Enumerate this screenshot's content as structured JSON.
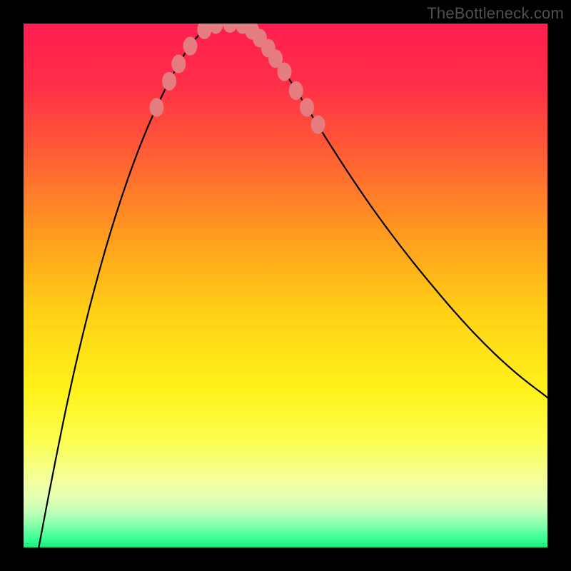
{
  "watermark": "TheBottleneck.com",
  "chart_data": {
    "type": "line",
    "title": "",
    "xlabel": "",
    "ylabel": "",
    "xlim": [
      0,
      1
    ],
    "ylim": [
      0,
      1
    ],
    "gradient_stops": [
      {
        "offset": 0.0,
        "color": "#ff1d51"
      },
      {
        "offset": 0.12,
        "color": "#ff3047"
      },
      {
        "offset": 0.25,
        "color": "#ff5e35"
      },
      {
        "offset": 0.4,
        "color": "#ff9a1f"
      },
      {
        "offset": 0.55,
        "color": "#ffd015"
      },
      {
        "offset": 0.7,
        "color": "#fff21a"
      },
      {
        "offset": 0.8,
        "color": "#fbff53"
      },
      {
        "offset": 0.86,
        "color": "#f5ff92"
      },
      {
        "offset": 0.9,
        "color": "#e9ffb0"
      },
      {
        "offset": 0.93,
        "color": "#c4ffb9"
      },
      {
        "offset": 0.96,
        "color": "#7dffa9"
      },
      {
        "offset": 0.985,
        "color": "#35ff93"
      },
      {
        "offset": 1.0,
        "color": "#18e87a"
      }
    ],
    "series": [
      {
        "name": "left-branch",
        "kind": "curve",
        "points": [
          [
            0.029,
            0.0
          ],
          [
            0.05,
            0.11
          ],
          [
            0.075,
            0.236
          ],
          [
            0.1,
            0.351
          ],
          [
            0.125,
            0.454
          ],
          [
            0.15,
            0.547
          ],
          [
            0.175,
            0.631
          ],
          [
            0.2,
            0.706
          ],
          [
            0.225,
            0.773
          ],
          [
            0.25,
            0.832
          ],
          [
            0.27,
            0.874
          ],
          [
            0.29,
            0.912
          ],
          [
            0.31,
            0.946
          ],
          [
            0.329,
            0.972
          ],
          [
            0.345,
            0.988
          ],
          [
            0.358,
            0.996
          ],
          [
            0.37,
            1.0
          ]
        ]
      },
      {
        "name": "valley",
        "kind": "curve",
        "points": [
          [
            0.37,
            1.0
          ],
          [
            0.385,
            1.0
          ],
          [
            0.4,
            1.0
          ],
          [
            0.415,
            1.0
          ]
        ]
      },
      {
        "name": "right-branch",
        "kind": "curve",
        "points": [
          [
            0.415,
            1.0
          ],
          [
            0.43,
            0.992
          ],
          [
            0.447,
            0.977
          ],
          [
            0.47,
            0.949
          ],
          [
            0.5,
            0.905
          ],
          [
            0.54,
            0.841
          ],
          [
            0.58,
            0.777
          ],
          [
            0.62,
            0.715
          ],
          [
            0.66,
            0.656
          ],
          [
            0.7,
            0.601
          ],
          [
            0.74,
            0.549
          ],
          [
            0.78,
            0.5
          ],
          [
            0.82,
            0.453
          ],
          [
            0.86,
            0.409
          ],
          [
            0.9,
            0.369
          ],
          [
            0.94,
            0.333
          ],
          [
            0.97,
            0.309
          ],
          [
            0.99,
            0.294
          ],
          [
            1.0,
            0.286
          ]
        ]
      }
    ],
    "markers": [
      {
        "x": 0.254,
        "y": 0.84
      },
      {
        "x": 0.278,
        "y": 0.89
      },
      {
        "x": 0.296,
        "y": 0.923
      },
      {
        "x": 0.318,
        "y": 0.957
      },
      {
        "x": 0.345,
        "y": 0.988
      },
      {
        "x": 0.367,
        "y": 0.998
      },
      {
        "x": 0.394,
        "y": 1.0
      },
      {
        "x": 0.418,
        "y": 0.998
      },
      {
        "x": 0.436,
        "y": 0.987
      },
      {
        "x": 0.451,
        "y": 0.972
      },
      {
        "x": 0.467,
        "y": 0.953
      },
      {
        "x": 0.481,
        "y": 0.933
      },
      {
        "x": 0.498,
        "y": 0.908
      },
      {
        "x": 0.52,
        "y": 0.872
      },
      {
        "x": 0.541,
        "y": 0.84
      },
      {
        "x": 0.562,
        "y": 0.807
      }
    ],
    "marker_style": {
      "fill": "#e47c80",
      "rx": 10,
      "ry": 13
    },
    "curve_style": {
      "stroke": "#000000",
      "width": 2.2
    }
  }
}
